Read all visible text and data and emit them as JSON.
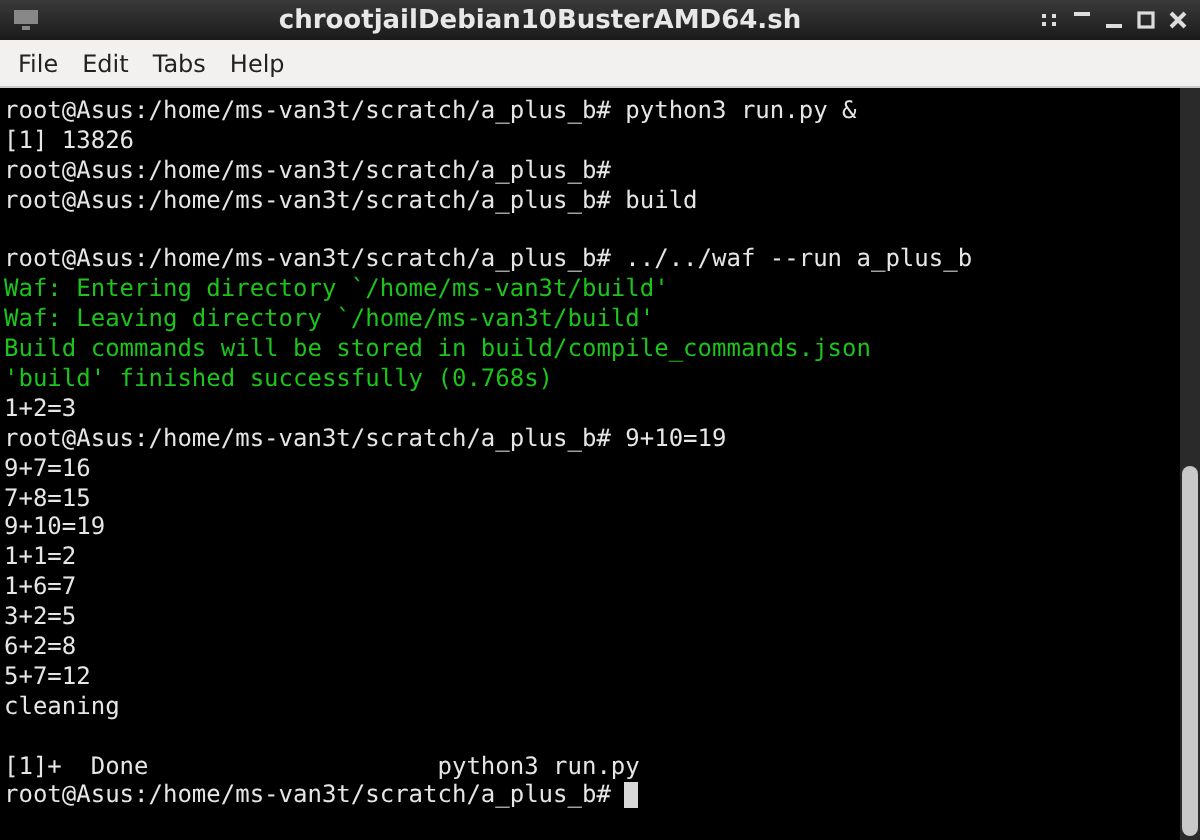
{
  "window": {
    "title": "chrootjailDebian10BusterAMD64.sh"
  },
  "menu": [
    "File",
    "Edit",
    "Tabs",
    "Help"
  ],
  "terminal": {
    "lines": [
      {
        "kind": "text",
        "text": "root@Asus:/home/ms-van3t/scratch/a_plus_b# python3 run.py &"
      },
      {
        "kind": "text",
        "text": "[1] 13826"
      },
      {
        "kind": "text",
        "text": "root@Asus:/home/ms-van3t/scratch/a_plus_b#"
      },
      {
        "kind": "text",
        "text": "root@Asus:/home/ms-van3t/scratch/a_plus_b# build"
      },
      {
        "kind": "blank"
      },
      {
        "kind": "text",
        "text": "root@Asus:/home/ms-van3t/scratch/a_plus_b# ../../waf --run a_plus_b"
      },
      {
        "kind": "green",
        "text": "Waf: Entering directory `/home/ms-van3t/build'"
      },
      {
        "kind": "green",
        "text": "Waf: Leaving directory `/home/ms-van3t/build'"
      },
      {
        "kind": "green",
        "text": "Build commands will be stored in build/compile_commands.json"
      },
      {
        "kind": "green",
        "text": "'build' finished successfully (0.768s)"
      },
      {
        "kind": "text",
        "text": "1+2=3"
      },
      {
        "kind": "text",
        "text": "root@Asus:/home/ms-van3t/scratch/a_plus_b# 9+10=19"
      },
      {
        "kind": "text",
        "text": "9+7=16"
      },
      {
        "kind": "text",
        "text": "7+8=15"
      },
      {
        "kind": "text",
        "text": "9+10=19"
      },
      {
        "kind": "text",
        "text": "1+1=2"
      },
      {
        "kind": "text",
        "text": "1+6=7"
      },
      {
        "kind": "text",
        "text": "3+2=5"
      },
      {
        "kind": "text",
        "text": "6+2=8"
      },
      {
        "kind": "text",
        "text": "5+7=12"
      },
      {
        "kind": "text",
        "text": "cleaning"
      },
      {
        "kind": "blank"
      },
      {
        "kind": "text",
        "text": "[1]+  Done                    python3 run.py"
      },
      {
        "kind": "input",
        "text": "root@Asus:/home/ms-van3t/scratch/a_plus_b#"
      }
    ]
  }
}
